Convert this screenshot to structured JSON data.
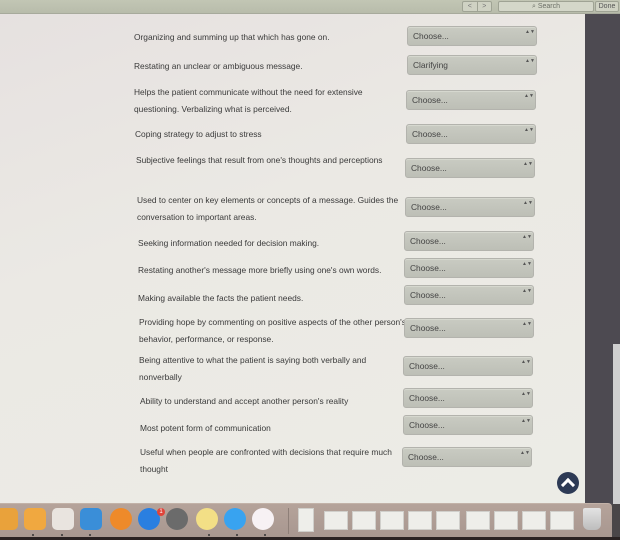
{
  "toolbar": {
    "back_label": "<",
    "forward_label": ">",
    "search_placeholder": "Search",
    "done_label": "Done"
  },
  "questions": [
    {
      "text": "Organizing and summing up that which has gone on.",
      "answer": "Choose..."
    },
    {
      "text": "Restating an unclear or ambiguous message.",
      "answer": "Clarifying"
    },
    {
      "text": "Helps the patient communicate without the need for extensive questioning. Verbalizing what is perceived.",
      "answer": "Choose..."
    },
    {
      "text": "Coping strategy to adjust to stress",
      "answer": "Choose..."
    },
    {
      "text": "Subjective feelings that result from one's thoughts and perceptions",
      "answer": "Choose..."
    },
    {
      "text": "Used to center on key elements or concepts of a message.  Guides the conversation to important areas.",
      "answer": "Choose..."
    },
    {
      "text": "Seeking information needed for decision making.",
      "answer": "Choose..."
    },
    {
      "text": "Restating another's message more briefly using one's own words.",
      "answer": "Choose..."
    },
    {
      "text": "Making available the facts the patient needs.",
      "answer": "Choose..."
    },
    {
      "text": "Providing hope by commenting on positive aspects of the other person's behavior, performance, or response.",
      "answer": "Choose..."
    },
    {
      "text": "Being attentive to what the patient is saying both verbally and nonverbally",
      "answer": "Choose..."
    },
    {
      "text": "Ability to understand and accept another person's reality",
      "answer": "Choose..."
    },
    {
      "text": "Most potent form of communication",
      "answer": "Choose..."
    },
    {
      "text": "Useful when people are confronted with decisions that require much thought",
      "answer": "Choose..."
    }
  ],
  "select_arrows": "▲▼",
  "dock": {
    "apps": [
      {
        "name": "Photos",
        "color": "#e9a23b"
      },
      {
        "name": "Pages",
        "color": "#f0a840"
      },
      {
        "name": "Numbers",
        "color": "#e9e4df"
      },
      {
        "name": "Keynote",
        "color": "#3a8ed8"
      },
      {
        "name": "iBooks",
        "color": "#ee8a2a"
      },
      {
        "name": "App Store",
        "color": "#2a7fe0"
      },
      {
        "name": "System Preferences",
        "color": "#6b6b6b"
      },
      {
        "name": "Stickies",
        "color": "#f3df86"
      },
      {
        "name": "Messages",
        "color": "#38a3f0"
      },
      {
        "name": "iTunes",
        "color": "#f7f1f4"
      }
    ],
    "app_store_badge": "1"
  }
}
